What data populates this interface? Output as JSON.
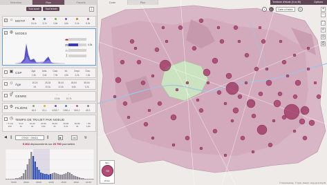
{
  "tabs": [
    "Sélection",
    "Flux",
    "Favoris"
  ],
  "buttons": {
    "select_all": "Tout ouvrir",
    "close_all": "Tout fermer"
  },
  "motif": {
    "label": "MOTIF",
    "values": [
      "15,1k",
      "3,7k",
      "3,6k",
      "4,6k",
      "3,1k",
      "6,3k"
    ]
  },
  "modes": {
    "label": "MODES",
    "bars": [
      {
        "icon": "🚗",
        "value": 0.0,
        "label": ""
      },
      {
        "icon": "🚌",
        "value": 0.55,
        "label": "6,3k"
      },
      {
        "icon": "🚲",
        "value": 0.0,
        "label": ""
      },
      {
        "icon": "🚶",
        "value": 0.0,
        "label": ""
      }
    ]
  },
  "csp": {
    "label": "CSP",
    "headers": [
      "Agri.",
      "Artis.",
      "Cadr.",
      "Int.",
      "Empl.",
      "Ouvr."
    ],
    "values": [
      "1,9k",
      "3,6k",
      "7,9k",
      "4,9k",
      "2,2k",
      "1,3k"
    ]
  },
  "age": {
    "label": "Âge",
    "headers": [
      "15-24",
      "25-34",
      "35-44",
      "45-54",
      "55-64"
    ],
    "values": [
      "64",
      "10,1k",
      "12,4k",
      "6,6k",
      "1,2k"
    ]
  },
  "genre": {
    "label": "GENRE",
    "headers": [
      "♀",
      "♂"
    ],
    "values": [
      "13,6k",
      "10,7k"
    ]
  },
  "filiere": {
    "label": "FILIÈRE",
    "values": [
      "46,5",
      "61,1",
      "4345,7",
      "1356,4",
      "806,2",
      "65,3"
    ]
  },
  "time": {
    "label": "TEMPS DE TRAJET PAR NOEUD",
    "headers": [
      "< 5 min",
      "5-10",
      "10-20",
      "20-30",
      "30-45",
      "45-60",
      "60-80",
      "> 80"
    ],
    "values": [
      "240",
      "1k",
      "3k",
      "3,5k",
      "6k",
      "5,2k",
      "3k",
      "1,8k"
    ]
  },
  "player": {
    "range": "07h00 - 09h15",
    "speed": "240",
    "count_line_pre": "9 264",
    "count_line_mid": " déplacements sur ",
    "count_line_post": "20 750",
    "count_line_end": " journaliers"
  },
  "hist": {
    "x_labels": [
      "03:00",
      "06:00",
      "09:00",
      "12:00",
      "15:00",
      "18:00",
      "21:00"
    ],
    "y_labels": [
      "2k",
      "1k"
    ]
  },
  "map": {
    "tabs": [
      "Carte",
      "Flux"
    ],
    "territory": "Territoire d'étude (Il ou Bi)",
    "options": "Options",
    "dropdown": "Carte à Halles",
    "legend_top": "5km",
    "legend_value": "700",
    "legend_unit": "20 km",
    "attribution": "© Openstreetmap - © Carto - Dataviz - Ange par le Flux Bi"
  },
  "colors": {
    "accent": "#6d4d5e",
    "flow": "#b0004b",
    "map_region": "#d7b1c1",
    "core": "#c8e2bd"
  }
}
